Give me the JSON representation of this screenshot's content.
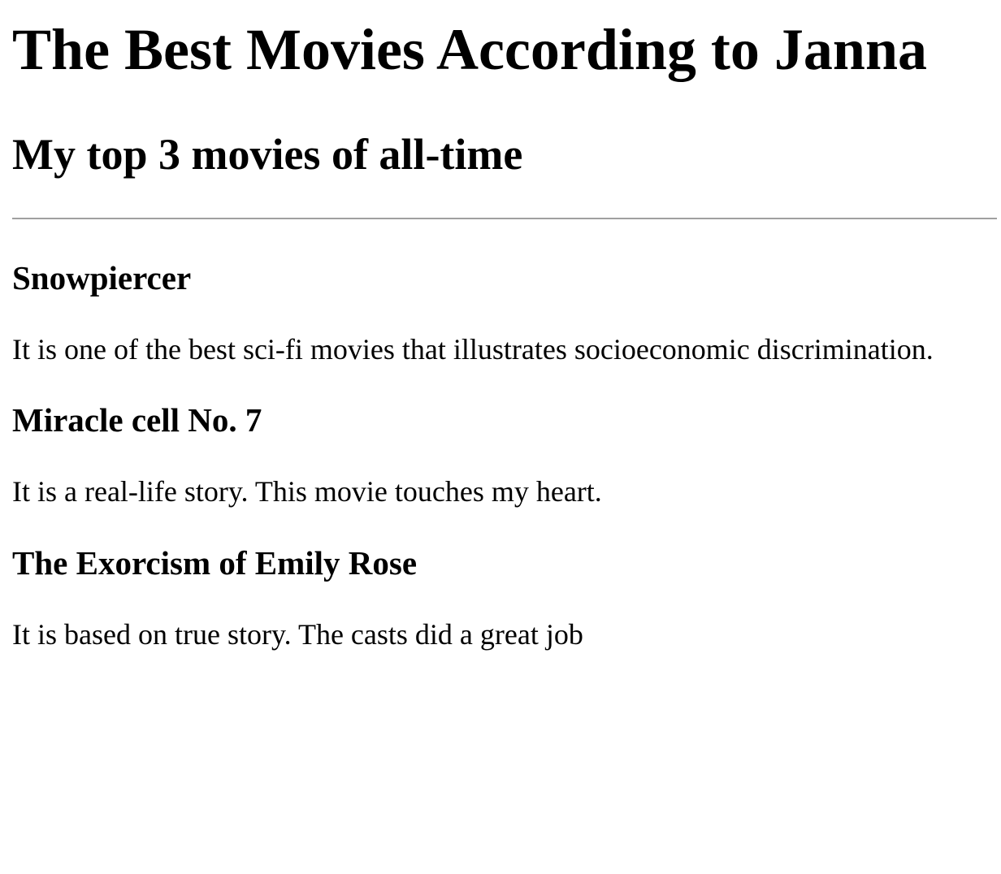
{
  "page": {
    "title": "The Best Movies According to Janna",
    "subtitle": "My top 3 movies of all-time"
  },
  "movies": [
    {
      "title": "Snowpiercer",
      "description": "It is one of the best sci-fi movies that illustrates socioeconomic discrimination."
    },
    {
      "title": "Miracle cell No. 7",
      "description": "It is a real-life story. This movie touches my heart."
    },
    {
      "title": "The Exorcism of Emily Rose",
      "description": "It is based on true story. The casts did a great job"
    }
  ]
}
